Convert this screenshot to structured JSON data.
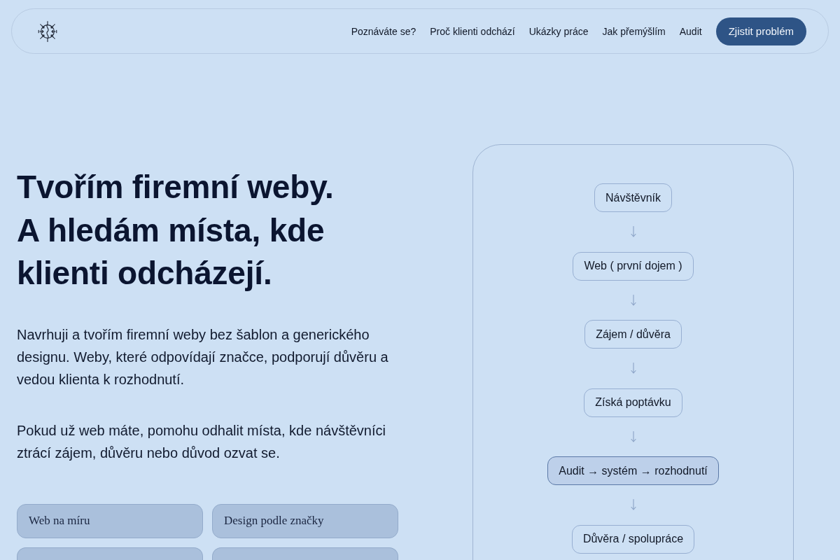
{
  "nav": {
    "links": [
      "Poznáváte se?",
      "Proč klienti odchází",
      "Ukázky práce",
      "Jak přemýšlím",
      "Audit"
    ],
    "cta": "Zjistit problém"
  },
  "hero": {
    "title_lines": [
      "Tvořím firemní weby.",
      "A hledám místa, kde klienti odcházejí."
    ],
    "paragraphs": [
      "Navrhuji a tvořím firemní weby bez šablon a generického designu. Weby, které odpovídají značce, podporují důvěru a vedou klienta k rozhodnutí.",
      "Pokud už web máte, pomohu odhalit místa, kde návštěvníci ztrácí zájem, důvěru nebo důvod ozvat se."
    ],
    "tags": [
      {
        "label": "Web na míru",
        "cut_off": false
      },
      {
        "label": "Design podle značky",
        "cut_off": false
      },
      {
        "cut_off": true
      },
      {
        "cut_off": true
      }
    ]
  },
  "flow": {
    "nodes": [
      {
        "label": "Návštěvník",
        "highlighted": false
      },
      {
        "label": "Web ( první dojem )",
        "highlighted": false
      },
      {
        "label": "Zájem / důvěra",
        "highlighted": false
      },
      {
        "label": "Získá poptávku",
        "highlighted": false
      },
      {
        "label": "Audit → systém → rozhodnutí",
        "highlighted": true
      },
      {
        "label": "Důvěra / spolupráce",
        "highlighted": false
      }
    ]
  }
}
